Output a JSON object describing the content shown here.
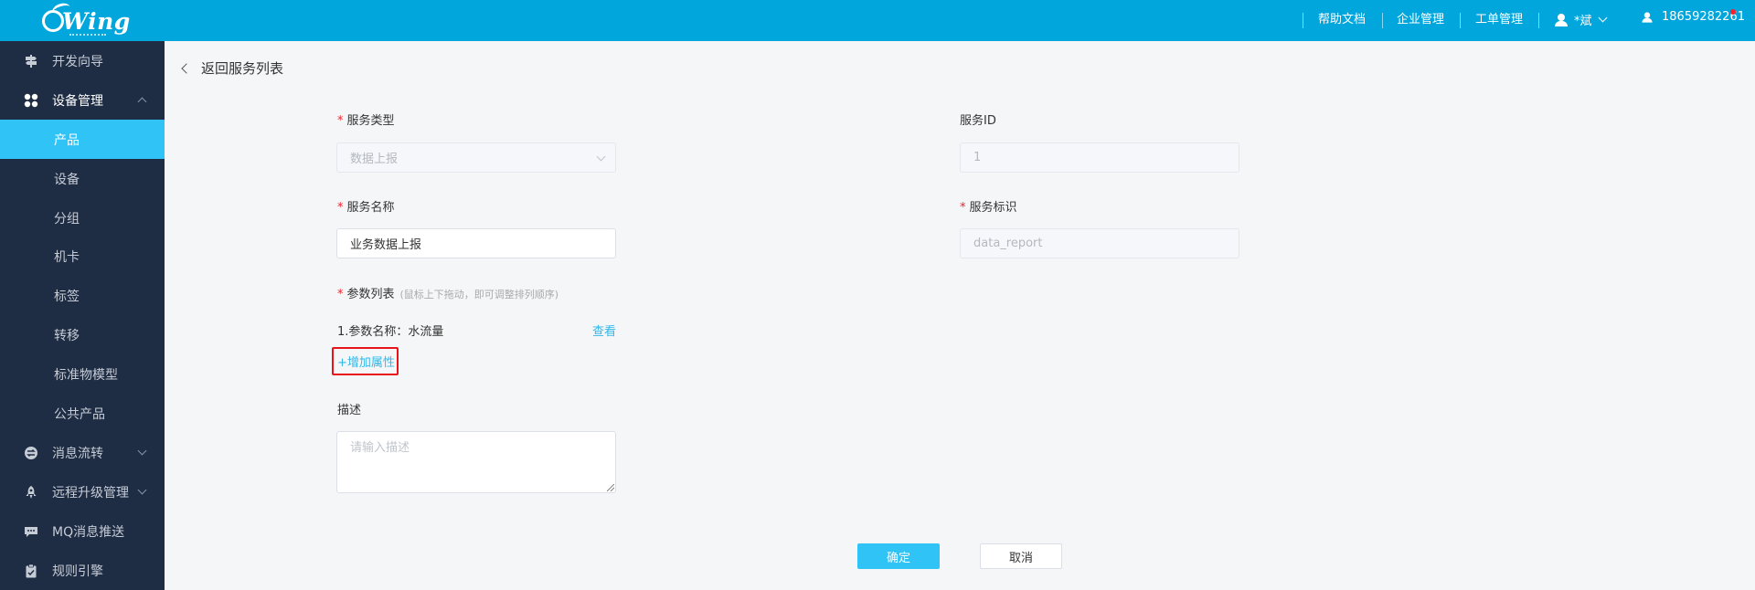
{
  "header": {
    "logo_text": "Wing",
    "nav": [
      "帮助文档",
      "企业管理",
      "工单管理"
    ],
    "user_name": "*斌",
    "account": "18659282261"
  },
  "sidebar": {
    "items": [
      {
        "label": "开发向导",
        "icon": "signpost-icon"
      },
      {
        "label": "设备管理",
        "icon": "grid-icon",
        "expanded": true
      },
      {
        "label": "产品",
        "active": true
      },
      {
        "label": "设备"
      },
      {
        "label": "分组"
      },
      {
        "label": "机卡"
      },
      {
        "label": "标签"
      },
      {
        "label": "转移"
      },
      {
        "label": "标准物模型"
      },
      {
        "label": "公共产品"
      },
      {
        "label": "消息流转",
        "icon": "flow-icon"
      },
      {
        "label": "远程升级管理",
        "icon": "rocket-icon"
      },
      {
        "label": "MQ消息推送",
        "icon": "chat-icon"
      },
      {
        "label": "规则引擎",
        "icon": "clipboard-icon"
      }
    ]
  },
  "main": {
    "back_label": "返回服务列表",
    "service_type": {
      "label": "服务类型",
      "value": "数据上报"
    },
    "service_id": {
      "label": "服务ID",
      "value": "1"
    },
    "service_name": {
      "label": "服务名称",
      "value": "业务数据上报"
    },
    "service_key": {
      "label": "服务标识",
      "value": "data_report"
    },
    "params": {
      "label": "参数列表",
      "hint": "(鼠标上下拖动，即可调整排列顺序)",
      "items": [
        {
          "text": "1.参数名称：水流量",
          "action": "查看"
        }
      ],
      "add_label": "+增加属性"
    },
    "description": {
      "label": "描述",
      "placeholder": "请输入描述"
    },
    "confirm_label": "确定",
    "cancel_label": "取消"
  },
  "colors": {
    "header": "#00a6dc",
    "sidebar": "#1e2c44",
    "active": "#2fc4f5",
    "link": "#2fb8ea"
  }
}
